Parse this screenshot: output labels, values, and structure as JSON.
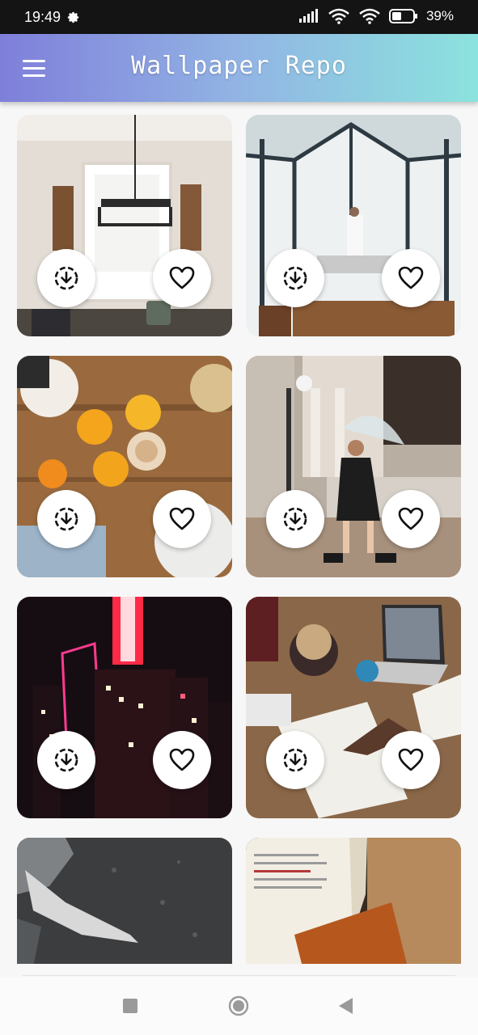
{
  "status_bar": {
    "time": "19:49",
    "battery": "39%",
    "icons": [
      "settings-gear-icon",
      "signal-icon",
      "wifi-icon",
      "wifi-icon",
      "battery-icon"
    ]
  },
  "app_bar": {
    "title": "Wallpaper Repo",
    "menu_icon": "hamburger-menu-icon",
    "gradient": [
      "#7f7fda",
      "#8be3de"
    ]
  },
  "wallpapers": [
    {
      "id": "dining-room",
      "actions": [
        "download-icon",
        "heart-outline-icon"
      ]
    },
    {
      "id": "glass-room",
      "actions": [
        "download-icon",
        "heart-outline-icon"
      ]
    },
    {
      "id": "cafe-toast",
      "actions": [
        "download-icon",
        "heart-outline-icon"
      ]
    },
    {
      "id": "umbrella-girl",
      "actions": [
        "download-icon",
        "heart-outline-icon"
      ]
    },
    {
      "id": "neon-city",
      "actions": [
        "download-icon",
        "heart-outline-icon"
      ]
    },
    {
      "id": "desk-sketch",
      "actions": [
        "download-icon",
        "heart-outline-icon"
      ]
    },
    {
      "id": "textured-stone",
      "actions": []
    },
    {
      "id": "open-book",
      "actions": []
    }
  ],
  "nav_bar": {
    "icons": [
      "recents-square-icon",
      "home-circle-icon",
      "back-triangle-icon"
    ]
  }
}
